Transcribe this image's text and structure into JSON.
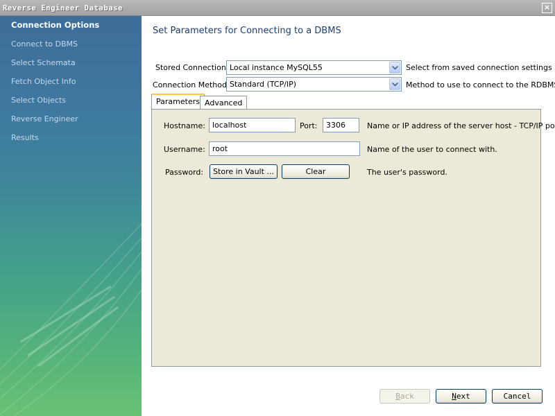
{
  "window": {
    "title": "Reverse Engineer Database",
    "close_symbol": "×"
  },
  "sidebar": {
    "items": [
      {
        "label": "Connection Options",
        "active": true
      },
      {
        "label": "Connect to DBMS",
        "active": false
      },
      {
        "label": "Select Schemata",
        "active": false
      },
      {
        "label": "Fetch Object Info",
        "active": false
      },
      {
        "label": "Select Objects",
        "active": false
      },
      {
        "label": "Reverse Engineer",
        "active": false
      },
      {
        "label": "Results",
        "active": false
      }
    ]
  },
  "main": {
    "title": "Set Parameters for Connecting to a DBMS",
    "stored_connection": {
      "label": "Stored Connection:",
      "value": "Local instance MySQL55",
      "hint": "Select from saved connection settings"
    },
    "connection_method": {
      "label": "Connection Method:",
      "value": "Standard (TCP/IP)",
      "hint": "Method to use to connect to the RDBMS"
    },
    "tabs": [
      {
        "label": "Parameters",
        "active": true
      },
      {
        "label": "Advanced",
        "active": false
      }
    ],
    "params": {
      "hostname_label": "Hostname:",
      "hostname_value": "localhost",
      "port_label": "Port:",
      "port_value": "3306",
      "hostname_hint": "Name or IP address of the server host - TCP/IP port.",
      "username_label": "Username:",
      "username_value": "root",
      "username_hint": "Name of the user to connect with.",
      "password_label": "Password:",
      "store_vault_label": "Store in Vault ...",
      "clear_label": "Clear",
      "password_hint": "The user's password."
    }
  },
  "footer": {
    "back_first": "B",
    "back_rest": "ack",
    "next_first": "N",
    "next_rest": "ext",
    "cancel_label": "Cancel"
  }
}
